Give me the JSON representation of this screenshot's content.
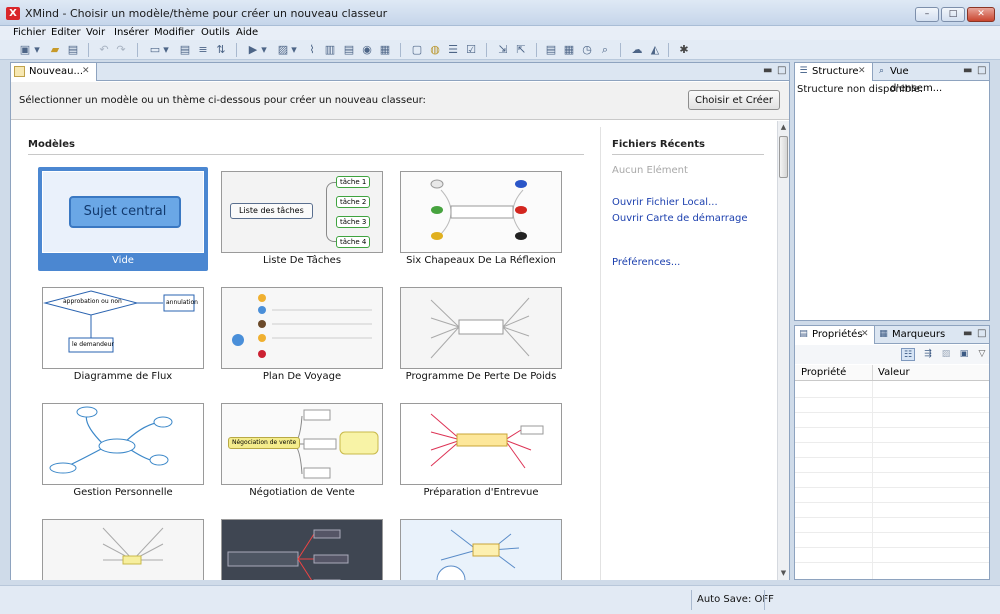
{
  "window": {
    "title": "XMind - Choisir un modèle/thème pour créer un nouveau classeur",
    "app_icon": "X",
    "buttons": {
      "minimize": "–",
      "maximize": "□",
      "close": "✕"
    }
  },
  "menu": [
    "Fichier",
    "Editer",
    "Voir",
    "Insérer",
    "Modifier",
    "Outils",
    "Aide"
  ],
  "editor": {
    "tab_label": "Nouveau...",
    "instruction": "Sélectionner un modèle ou un thème ci-dessous pour créer un nouveau classeur:",
    "create_button": "Choisir et Créer",
    "models_title": "Modèles",
    "templates": [
      {
        "label": "Vide",
        "central": "Sujet central",
        "selected": true
      },
      {
        "label": "Liste De Tâches",
        "root": "Liste des tâches",
        "items": [
          "tâche 1",
          "tâche 2",
          "tâche 3",
          "tâche 4"
        ]
      },
      {
        "label": "Six Chapeaux De La Réflexion"
      },
      {
        "label": "Diagramme de Flux",
        "nodes": [
          "approbation ou non",
          "annulation",
          "le demandeur"
        ]
      },
      {
        "label": "Plan De Voyage"
      },
      {
        "label": "Programme De Perte De Poids"
      },
      {
        "label": "Gestion Personnelle"
      },
      {
        "label": "Négotiation de Vente",
        "root": "Négociation de vente"
      },
      {
        "label": "Préparation d'Entrevue"
      },
      {
        "label": ""
      },
      {
        "label": ""
      },
      {
        "label": ""
      }
    ],
    "recent": {
      "title": "Fichiers Récents",
      "empty": "Aucun Elément",
      "open_local": "Ouvrir Fichier Local...",
      "open_start_map": "Ouvrir Carte de démarrage",
      "preferences": "Préférences..."
    }
  },
  "structure_panel": {
    "tabs": [
      "Structure",
      "Vue d'ensem..."
    ],
    "message": "Structure non disponible."
  },
  "properties_panel": {
    "tabs": [
      "Propriétés",
      "Marqueurs"
    ],
    "columns": [
      "Propriété",
      "Valeur"
    ]
  },
  "status": {
    "autosave": "Auto Save: OFF"
  }
}
